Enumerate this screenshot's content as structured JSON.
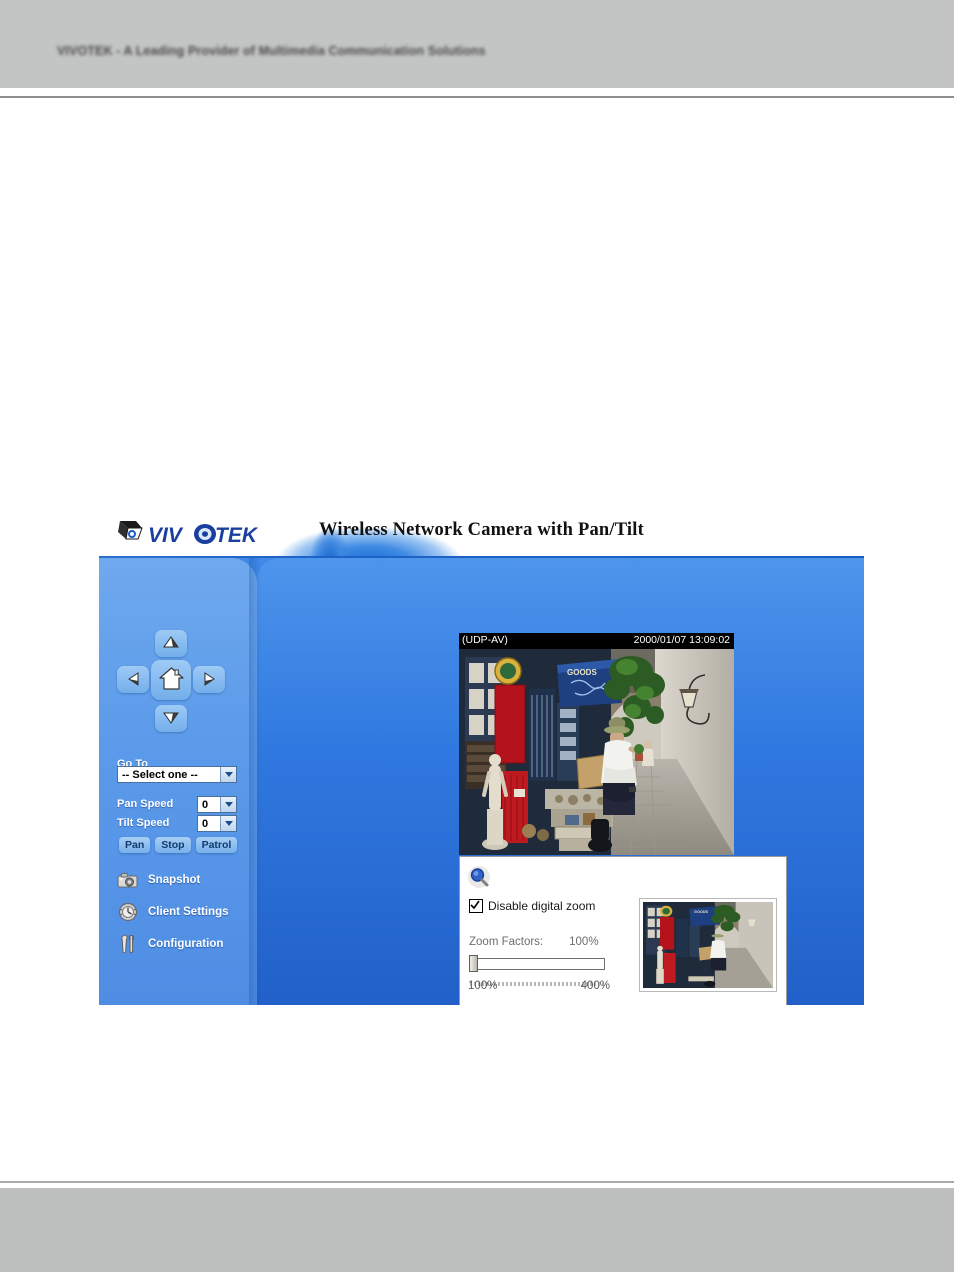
{
  "document": {
    "header_text": "VIVOTEK - A Leading Provider of Multimedia Communication Solutions"
  },
  "app": {
    "logo_text": "VIVOTEK",
    "title": "Wireless Network Camera with Pan/Tilt"
  },
  "sidebar": {
    "ptz": {
      "up_name": "tilt-up",
      "down_name": "tilt-down",
      "left_name": "pan-left",
      "right_name": "pan-right",
      "home_name": "home"
    },
    "goto": {
      "label": "Go To",
      "selected": "-- Select one --"
    },
    "pan_speed": {
      "label": "Pan Speed",
      "value": "0"
    },
    "tilt_speed": {
      "label": "Tilt Speed",
      "value": "0"
    },
    "actions": [
      {
        "label": "Pan"
      },
      {
        "label": "Stop"
      },
      {
        "label": "Patrol"
      }
    ],
    "menu": [
      {
        "label": "Snapshot",
        "icon": "camera-icon"
      },
      {
        "label": "Client Settings",
        "icon": "clock-gear-icon"
      },
      {
        "label": "Configuration",
        "icon": "tools-icon"
      }
    ]
  },
  "video": {
    "osd_left": "(UDP-AV)",
    "osd_right": "2000/01/07 13:09:02"
  },
  "zoom_dialog": {
    "magnifier_icon": "magnifier-icon",
    "disable_zoom_label": "Disable digital zoom",
    "disable_zoom_checked": true,
    "zoom_factors_label": "Zoom Factors:",
    "zoom_factors_value": "100%",
    "slider_min_label": "100%",
    "slider_max_label": "400%",
    "slider_position_percent": 0
  },
  "colors": {
    "brand_blue": "#1b5fc4",
    "sidebar_blue": "#5c9bea",
    "stage_blue": "#2f7ce2",
    "page_gray": "#c3c5c4"
  }
}
